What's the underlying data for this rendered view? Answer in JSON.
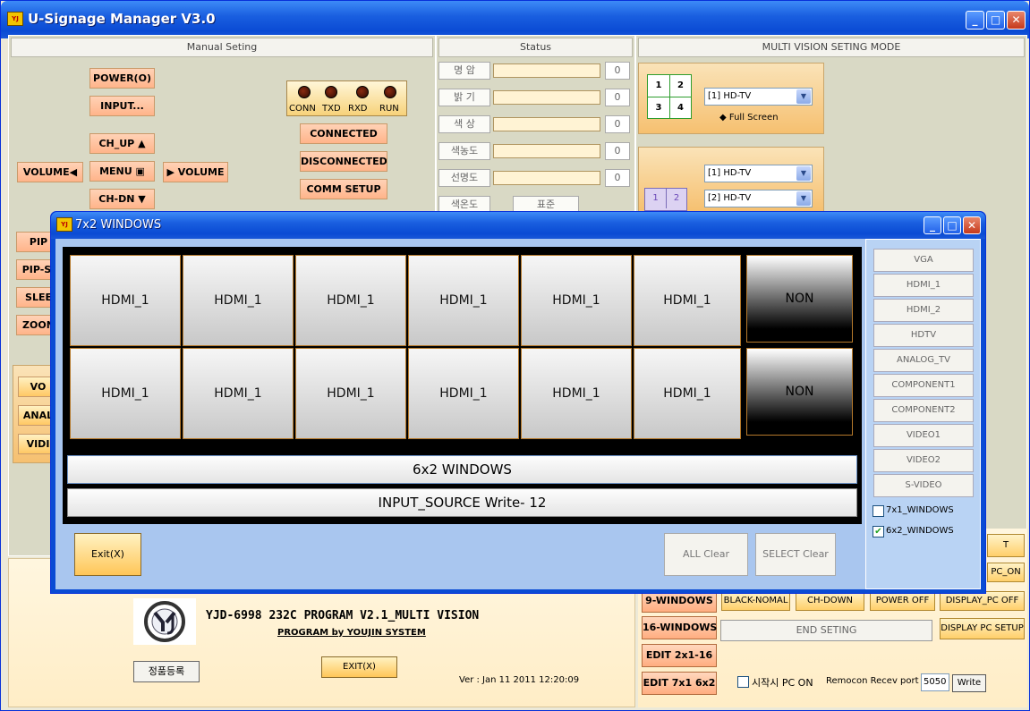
{
  "main": {
    "title": "U-Signage Manager V3.0"
  },
  "manual": {
    "header": "Manual Seting",
    "power": "POWER(O)",
    "input": "INPUT...",
    "ch_up": "CH_UP ▲",
    "menu": "MENU ▣",
    "ch_dn": "CH-DN ▼",
    "vol_left": "VOLUME◀",
    "vol_right": "▶ VOLUME",
    "connected": "CONNECTED",
    "disconnected": "DISCONNECTED",
    "comm_setup": "COMM SETUP",
    "side": [
      "PIP",
      "PIP-SI",
      "SLEE",
      "ZOON"
    ],
    "lower": [
      "VO",
      "ANAL",
      "VIDI"
    ]
  },
  "leds": [
    "CONN",
    "TXD",
    "RXD",
    "RUN"
  ],
  "status": {
    "header": "Status",
    "rows": [
      {
        "label": "명 암",
        "value": "0"
      },
      {
        "label": "밝 기",
        "value": "0"
      },
      {
        "label": "색 상",
        "value": "0"
      },
      {
        "label": "색농도",
        "value": "0"
      },
      {
        "label": "선명도",
        "value": "0"
      }
    ],
    "last_label": "색온도",
    "last_value": "표준"
  },
  "multi": {
    "header": "MULTI VISION SETING MODE",
    "grid": [
      "1",
      "2",
      "3",
      "4"
    ],
    "sel1": "[1] HD-TV",
    "fullscreen": "◆ Full Screen",
    "sel2": "[1] HD-TV",
    "sel3": "[2] HD-TV",
    "mini": [
      "1",
      "2"
    ]
  },
  "child": {
    "title": "7x2 WINDOWS",
    "row1": [
      "HDMI_1",
      "HDMI_1",
      "HDMI_1",
      "HDMI_1",
      "HDMI_1",
      "HDMI_1"
    ],
    "row2": [
      "HDMI_1",
      "HDMI_1",
      "HDMI_1",
      "HDMI_1",
      "HDMI_1",
      "HDMI_1"
    ],
    "non1": "NON",
    "non2": "NON",
    "bar1": "6x2 WINDOWS",
    "bar2": "INPUT_SOURCE  Write- 12",
    "exit": "Exit(X)",
    "all_clear": "ALL Clear",
    "select_clear": "SELECT Clear",
    "sources": [
      "VGA",
      "HDMI_1",
      "HDMI_2",
      "HDTV",
      "ANALOG_TV",
      "COMPONENT1",
      "COMPONENT2",
      "VIDEO1",
      "VIDEO2",
      "S-VIDEO"
    ],
    "chk1": "7x1_WINDOWS",
    "chk2": "6x2_WINDOWS"
  },
  "bottom": {
    "brand": "YJD-6998 232C  PROGRAM V2.1_MULTI VISION",
    "by": "PROGRAM by YOUJIN SYSTEM",
    "register": "정품등록",
    "exit": "EXIT(X)",
    "ver": "Ver :  Jan 11 2011   12:20:09",
    "right_edge1": "T",
    "right_edge2": "PC_ON",
    "nine": "9-WINDOWS",
    "sixteen": "16-WINDOWS",
    "edit1": "EDIT 2x1-16",
    "edit2": "EDIT 7x1 6x2",
    "black": "BLACK-NOMAL",
    "chdown": "CH-DOWN",
    "poweroff": "POWER OFF",
    "dispoff": "DISPLAY_PC OFF",
    "endset": "END SETING",
    "dispsetup": "DISPLAY PC SETUP",
    "startpc": "시작시 PC ON",
    "remocon": "Remocon Recev port",
    "port": "5050",
    "write": "Write"
  }
}
